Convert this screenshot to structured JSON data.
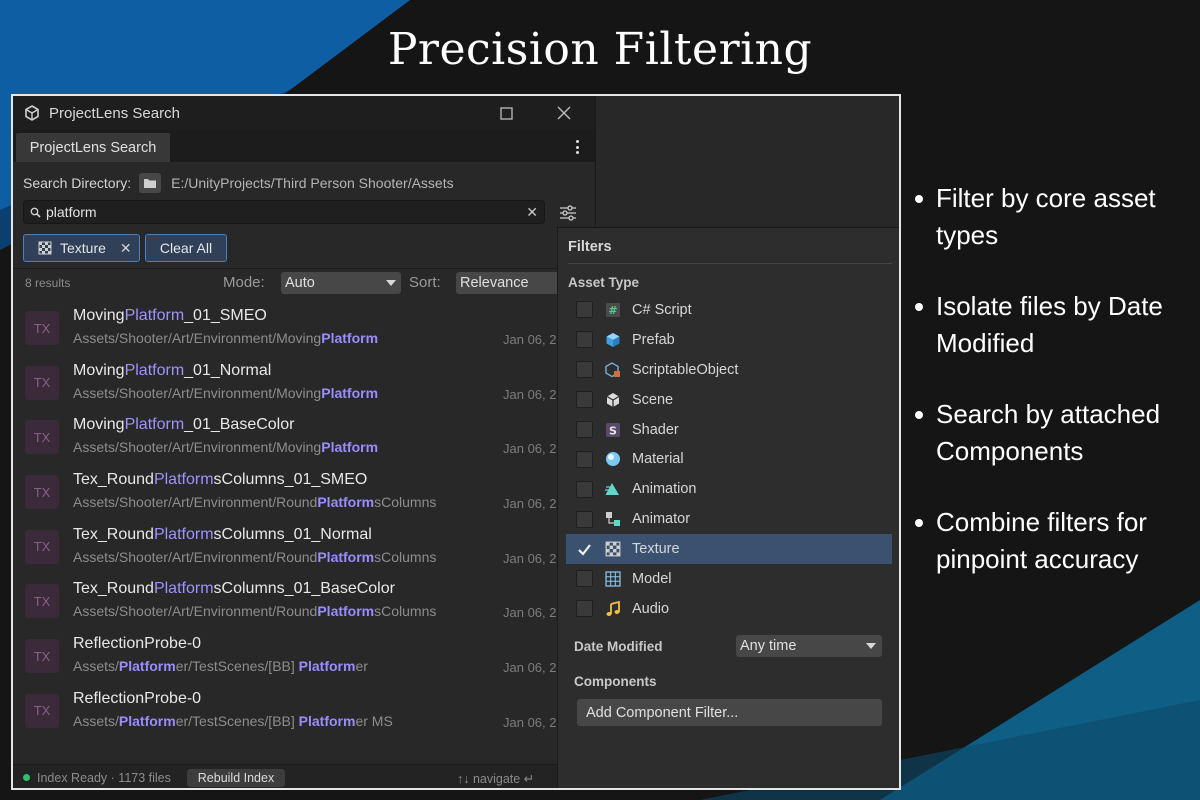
{
  "headline": "Precision Filtering",
  "window": {
    "title": "ProjectLens Search",
    "tab": "ProjectLens Search",
    "search_directory_label": "Search Directory:",
    "search_directory_path": "E:/UnityProjects/Third Person Shooter/Assets",
    "search_value": "platform",
    "active_chip": "Texture",
    "clear_all": "Clear All",
    "results_count": "8 results",
    "mode_label": "Mode:",
    "mode_value": "Auto",
    "sort_label": "Sort:",
    "sort_value": "Relevance",
    "thumb_label": "TX",
    "status_text": "Index Ready · 1173 files",
    "rebuild_label": "Rebuild Index",
    "nav_hint": "↑↓ navigate ↵"
  },
  "results": [
    {
      "name": [
        [
          "Moving",
          ""
        ],
        [
          "Platform",
          "hl"
        ],
        [
          "_01_SMEO",
          ""
        ]
      ],
      "path": [
        [
          "Assets/Shooter/Art/Environment/Moving",
          ""
        ],
        [
          "Platform",
          "hl"
        ]
      ],
      "date": "Jan 06, 2"
    },
    {
      "name": [
        [
          "Moving",
          ""
        ],
        [
          "Platform",
          "hl"
        ],
        [
          "_01_Normal",
          ""
        ]
      ],
      "path": [
        [
          "Assets/Shooter/Art/Environment/Moving",
          ""
        ],
        [
          "Platform",
          "hl"
        ]
      ],
      "date": "Jan 06, 2"
    },
    {
      "name": [
        [
          "Moving",
          ""
        ],
        [
          "Platform",
          "hl"
        ],
        [
          "_01_BaseColor",
          ""
        ]
      ],
      "path": [
        [
          "Assets/Shooter/Art/Environment/Moving",
          ""
        ],
        [
          "Platform",
          "hl"
        ]
      ],
      "date": "Jan 06, 2"
    },
    {
      "name": [
        [
          "Tex_Round",
          ""
        ],
        [
          "Platform",
          "hl"
        ],
        [
          "sColumns_01_SMEO",
          ""
        ]
      ],
      "path": [
        [
          "Assets/Shooter/Art/Environment/Round",
          ""
        ],
        [
          "Platform",
          "hl"
        ],
        [
          "sColumns",
          ""
        ]
      ],
      "date": "Jan 06, 2"
    },
    {
      "name": [
        [
          "Tex_Round",
          ""
        ],
        [
          "Platform",
          "hl"
        ],
        [
          "sColumns_01_Normal",
          ""
        ]
      ],
      "path": [
        [
          "Assets/Shooter/Art/Environment/Round",
          ""
        ],
        [
          "Platform",
          "hl"
        ],
        [
          "sColumns",
          ""
        ]
      ],
      "date": "Jan 06, 2"
    },
    {
      "name": [
        [
          "Tex_Round",
          ""
        ],
        [
          "Platform",
          "hl"
        ],
        [
          "sColumns_01_BaseColor",
          ""
        ]
      ],
      "path": [
        [
          "Assets/Shooter/Art/Environment/Round",
          ""
        ],
        [
          "Platform",
          "hl"
        ],
        [
          "sColumns",
          ""
        ]
      ],
      "date": "Jan 06, 2"
    },
    {
      "name": [
        [
          "ReflectionProbe-0",
          ""
        ]
      ],
      "path": [
        [
          "Assets/",
          ""
        ],
        [
          "Platform",
          "hl"
        ],
        [
          "er/TestScenes/[BB] ",
          ""
        ],
        [
          "Platform",
          "hl"
        ],
        [
          "er",
          ""
        ]
      ],
      "date": "Jan 06, 2"
    },
    {
      "name": [
        [
          "ReflectionProbe-0",
          ""
        ]
      ],
      "path": [
        [
          "Assets/",
          ""
        ],
        [
          "Platform",
          "hl"
        ],
        [
          "er/TestScenes/[BB] ",
          ""
        ],
        [
          "Platform",
          "hl"
        ],
        [
          "er MS",
          ""
        ]
      ],
      "date": "Jan 06, 2"
    }
  ],
  "filters": {
    "title": "Filters",
    "asset_type_label": "Asset Type",
    "asset_types": [
      {
        "label": "C# Script",
        "icon": "csharp-script-icon",
        "checked": false
      },
      {
        "label": "Prefab",
        "icon": "prefab-icon",
        "checked": false
      },
      {
        "label": "ScriptableObject",
        "icon": "scriptable-object-icon",
        "checked": false
      },
      {
        "label": "Scene",
        "icon": "scene-icon",
        "checked": false
      },
      {
        "label": "Shader",
        "icon": "shader-icon",
        "checked": false
      },
      {
        "label": "Material",
        "icon": "material-icon",
        "checked": false
      },
      {
        "label": "Animation",
        "icon": "animation-icon",
        "checked": false
      },
      {
        "label": "Animator",
        "icon": "animator-icon",
        "checked": false
      },
      {
        "label": "Texture",
        "icon": "texture-icon",
        "checked": true
      },
      {
        "label": "Model",
        "icon": "model-icon",
        "checked": false
      },
      {
        "label": "Audio",
        "icon": "audio-icon",
        "checked": false
      }
    ],
    "date_modified_label": "Date Modified",
    "date_modified_value": "Any time",
    "components_label": "Components",
    "add_component_label": "Add Component Filter..."
  },
  "bullets": [
    "Filter by core asset types",
    "Isolate files by Date Modified",
    "Search by attached Components",
    "Combine filters for pinpoint accuracy"
  ],
  "colors": {
    "accent_blue": "#4a82c0",
    "highlight": "#8f85ff",
    "status_ok": "#2fc06b",
    "selected_row": "#3a5270"
  }
}
